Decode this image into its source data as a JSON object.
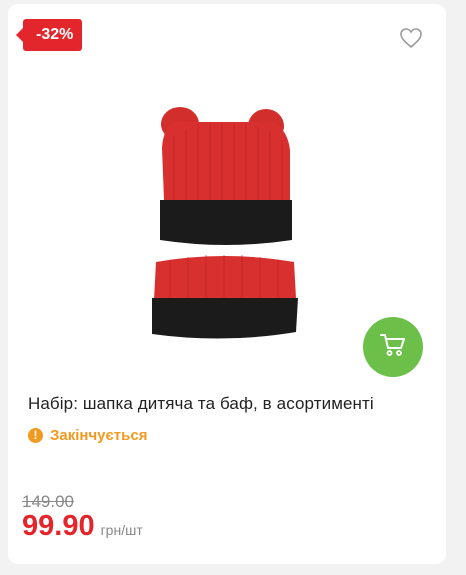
{
  "product": {
    "discount_badge": "-32%",
    "title": "Набір: шапка дитяча та баф, в асортименті",
    "status": "Закінчується",
    "old_price": "149.00",
    "price": "99.90",
    "unit": "грн/шт",
    "image_alt": "knitted hat with pom-pom ears and snood"
  },
  "icons": {
    "favorite": "heart-outline-icon",
    "cart": "shopping-cart-icon",
    "status": "warning-circle-icon"
  },
  "colors": {
    "accent_red": "#e3262c",
    "cart_green": "#6cc04a",
    "status_orange": "#f29a1f"
  }
}
